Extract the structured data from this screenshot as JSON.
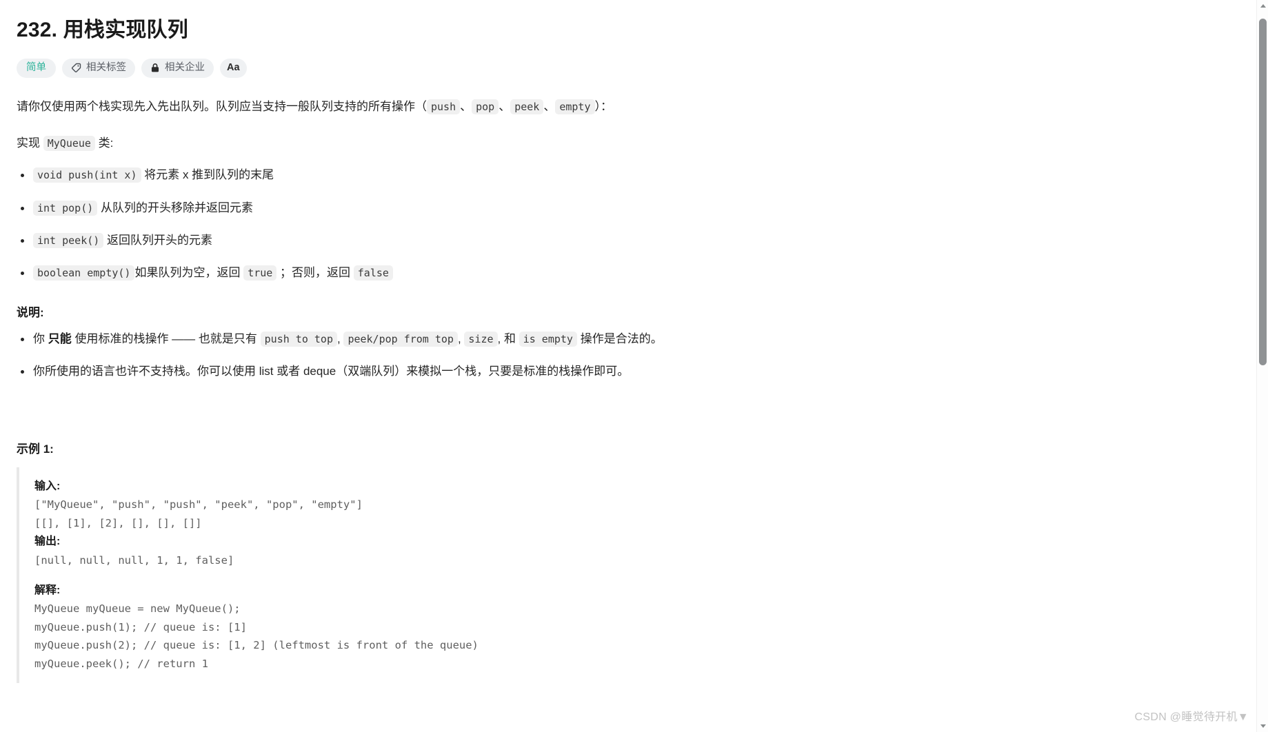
{
  "page": {
    "title": "232. 用栈实现队列"
  },
  "badges": [
    {
      "label": "简单",
      "icon": "none",
      "style": "difficulty"
    },
    {
      "label": "相关标签",
      "icon": "tag-icon",
      "style": "normal"
    },
    {
      "label": "相关企业",
      "icon": "lock-icon",
      "style": "normal"
    },
    {
      "label": "Aa",
      "icon": "font-size-icon",
      "style": "icon-only"
    }
  ],
  "intro": {
    "lead_1": "请你仅使用两个栈实现先入先出队列。队列应当支持一般队列支持的所有操作（",
    "ops": [
      "push",
      "pop",
      "peek",
      "empty"
    ],
    "sep": "、",
    "lead_2": "）：",
    "impl_prefix": "实现 ",
    "impl_code": "MyQueue",
    "impl_suffix": " 类:"
  },
  "methods": [
    {
      "code": "void push(int x)",
      "text": "将元素 x 推到队列的末尾"
    },
    {
      "code": "int pop()",
      "text": "从队列的开头移除并返回元素"
    },
    {
      "code": "int peek()",
      "text": "返回队列开头的元素"
    }
  ],
  "empty_method": {
    "code": "boolean empty()",
    "t1": "如果队列为空，返回 ",
    "c1": "true",
    "t2": " ；否则，返回 ",
    "c2": "false"
  },
  "notes": {
    "heading": "说明:",
    "item1": {
      "t1": "你 ",
      "bold": "只能",
      "t2": " 使用标准的栈操作 —— 也就是只有 ",
      "c1": "push to top",
      "t3": ", ",
      "c2": "peek/pop from top",
      "t4": ", ",
      "c3": "size",
      "t5": ", 和 ",
      "c4": "is empty",
      "t6": " 操作是合法的。"
    },
    "item2": "你所使用的语言也许不支持栈。你可以使用 list 或者 deque（双端队列）来模拟一个栈，只要是标准的栈操作即可。"
  },
  "example": {
    "title": "示例 1:",
    "input_label": "输入:",
    "input_lines": [
      "[\"MyQueue\", \"push\", \"push\", \"peek\", \"pop\", \"empty\"]",
      "[[], [1], [2], [], [], []]"
    ],
    "output_label": "输出:",
    "output_lines": [
      "[null, null, null, 1, 1, false]"
    ],
    "explain_label": "解释:",
    "explain_lines": [
      "MyQueue myQueue = new MyQueue();",
      "myQueue.push(1); // queue is: [1]",
      "myQueue.push(2); // queue is: [1, 2] (leftmost is front of the queue)",
      "myQueue.peek(); // return 1"
    ]
  },
  "watermark": "CSDN @睡觉待开机▼",
  "colors": {
    "difficulty_green": "#2db39a",
    "badge_bg": "#eff1f3",
    "code_bg": "#f0f0f0",
    "text": "#262626",
    "scrollbar_thumb": "#8f9294"
  }
}
